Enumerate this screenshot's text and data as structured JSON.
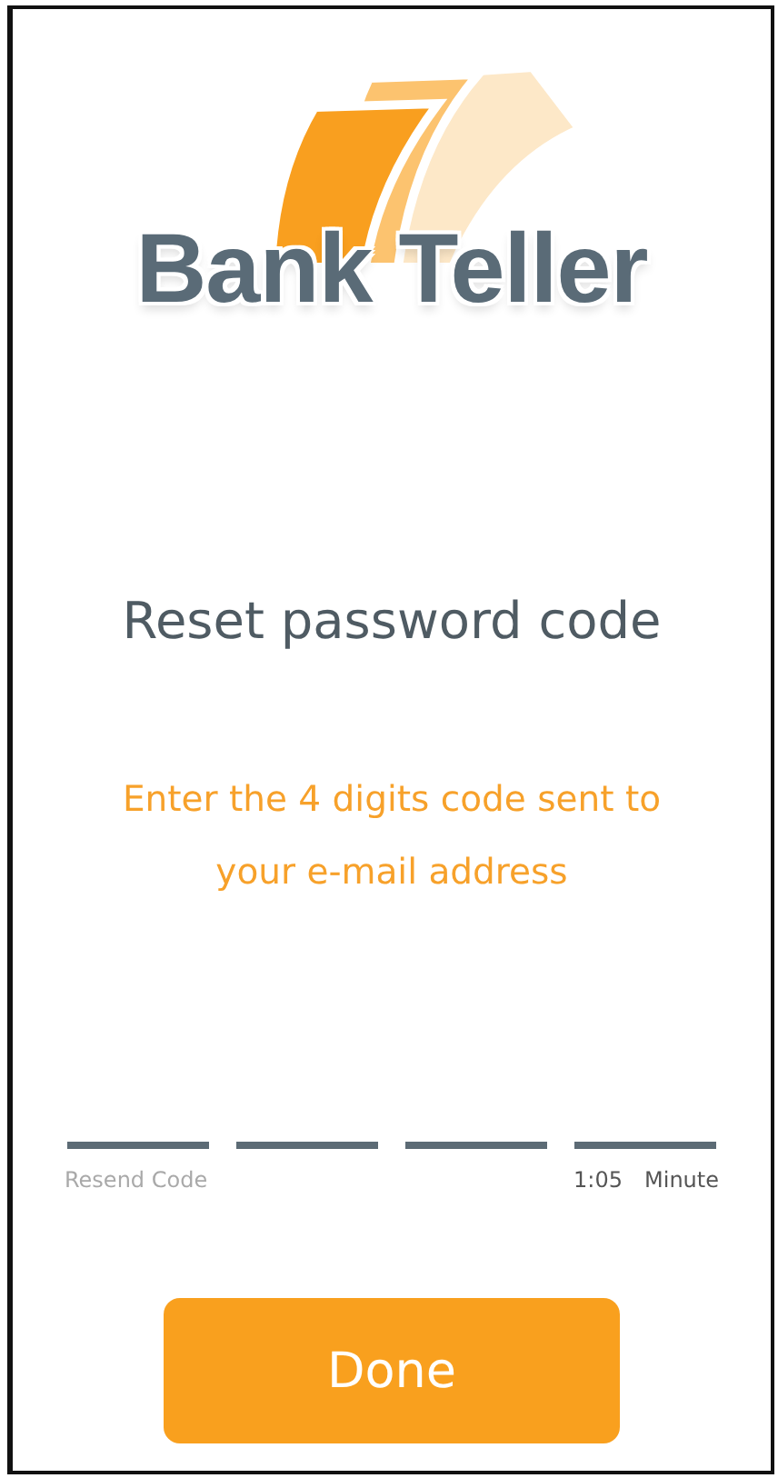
{
  "logo": {
    "text": "Bank Teller"
  },
  "title": "Reset password code",
  "instructions": "Enter the 4 digits code sent to your e-mail address",
  "code_fields": [
    {
      "kind": "digit"
    },
    {
      "kind": "digit"
    },
    {
      "kind": "digit"
    },
    {
      "kind": "digit"
    }
  ],
  "resend_link": "Resend Code",
  "timer": {
    "time": "1:05",
    "unit": "Minute"
  },
  "done_button": "Done"
}
